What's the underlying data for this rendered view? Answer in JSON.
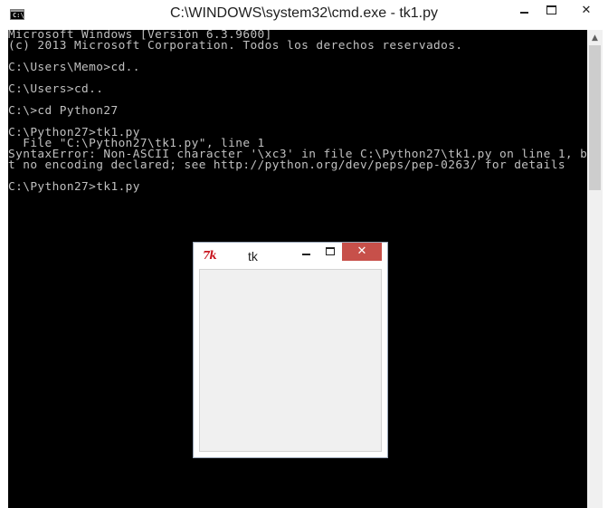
{
  "cmd_window": {
    "title": "C:\\WINDOWS\\system32\\cmd.exe - tk1.py",
    "controls": {
      "minimize": "minimize",
      "maximize": "maximize",
      "close": "✕"
    },
    "console_lines": [
      "Microsoft Windows [Versión 6.3.9600]",
      "(c) 2013 Microsoft Corporation. Todos los derechos reservados.",
      "",
      "C:\\Users\\Memo>cd..",
      "",
      "C:\\Users>cd..",
      "",
      "C:\\>cd Python27",
      "",
      "C:\\Python27>tk1.py",
      "  File \"C:\\Python27\\tk1.py\", line 1",
      "SyntaxError: Non-ASCII character '\\xc3' in file C:\\Python27\\tk1.py on line 1, bu",
      "t no encoding declared; see http://python.org/dev/peps/pep-0263/ for details",
      "",
      "C:\\Python27>tk1.py"
    ]
  },
  "tk_window": {
    "title": "tk",
    "icon_label": "7k",
    "close_label": "✕"
  },
  "colors": {
    "console_bg": "#000000",
    "console_text": "#c0c0c0",
    "tk_close": "#c7504a",
    "tk_client": "#f0f0f0"
  }
}
